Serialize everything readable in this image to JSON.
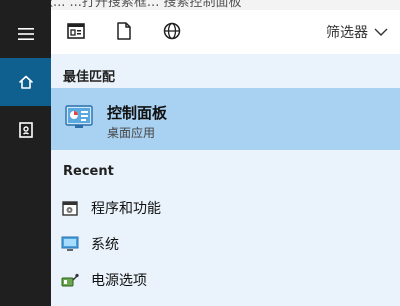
{
  "window": {
    "top_strip_text": "款...  ...打开搜索框... 搜索控制面板"
  },
  "rail": {
    "items": [
      {
        "id": "menu",
        "icon": "hamburger-icon"
      },
      {
        "id": "home",
        "icon": "home-icon",
        "active": true
      },
      {
        "id": "notebook",
        "icon": "notebook-icon"
      }
    ]
  },
  "toolbar": {
    "icons": [
      "app-icon",
      "document-icon",
      "globe-icon"
    ],
    "filter_label": "筛选器"
  },
  "sections": {
    "best_match_title": "最佳匹配",
    "recent_title": "Recent"
  },
  "best_match": {
    "title": "控制面板",
    "subtitle": "桌面应用"
  },
  "recent_items": [
    {
      "label": "程序和功能",
      "icon": "programs-icon"
    },
    {
      "label": "系统",
      "icon": "system-icon"
    },
    {
      "label": "电源选项",
      "icon": "power-icon"
    }
  ],
  "colors": {
    "rail_bg": "#1f1f1f",
    "rail_active": "#0f5f8f",
    "panel_bg": "#eaf3fb",
    "selected_bg": "#a9d1f2"
  }
}
